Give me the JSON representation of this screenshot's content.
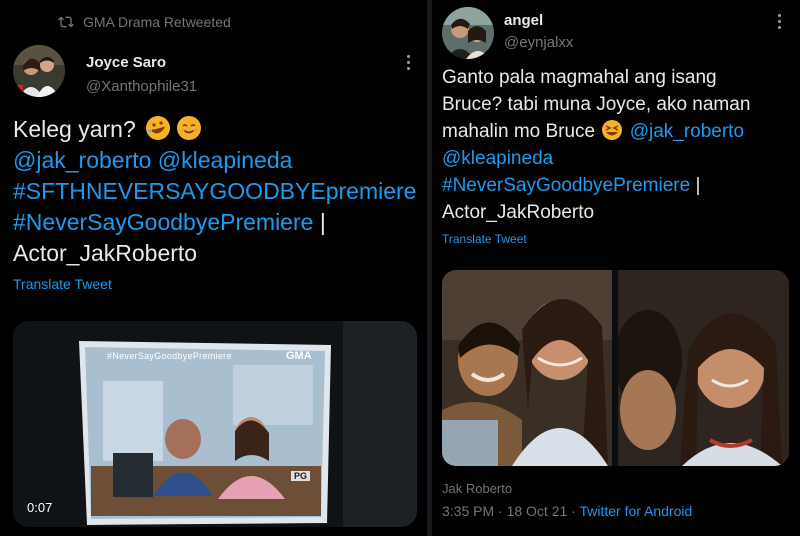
{
  "left_tweet": {
    "retweet_label": "GMA Drama Retweeted",
    "author_name": "Joyce Saro",
    "author_handle": "@Xanthophile31",
    "text_plain": "Keleg yarn?",
    "emoji": [
      "rolling-on-floor-laughing",
      "smiling-face"
    ],
    "mentions": "@jak_roberto @kleapineda",
    "hashtag_1": "#SFTHNEVERSAYGOODBYEpremiere",
    "hashtag_2": "#NeverSayGoodbyePremiere",
    "separator": "|",
    "tail": "Actor_JakRoberto",
    "translate": "Translate Tweet",
    "video": {
      "duration": "0:07",
      "overlay_hashtag": "#NeverSayGoodbyePremiere",
      "channel_logo": "GMA",
      "rating": "PG"
    }
  },
  "right_tweet": {
    "author_name": "angel",
    "author_handle": "@eynjalxx",
    "line_1": "Ganto pala magmahal ang isang",
    "line_2": "Bruce? tabi muna Joyce, ako naman",
    "line_3_text": "mahalin mo Bruce",
    "line_3_link": "@jak_roberto",
    "line_4": "@kleapineda",
    "line_5_link": "#NeverSayGoodbyePremiere",
    "separator": "|",
    "line_6": "Actor_JakRoberto",
    "translate": "Translate Tweet",
    "tagged": "Jak Roberto",
    "timestamp": "3:35 PM · 18 Oct 21 · ",
    "source": "Twitter for Android"
  },
  "colors": {
    "link": "#1d9bf0",
    "muted": "#71767b",
    "background": "#000000",
    "text": "#e7e9ea"
  }
}
